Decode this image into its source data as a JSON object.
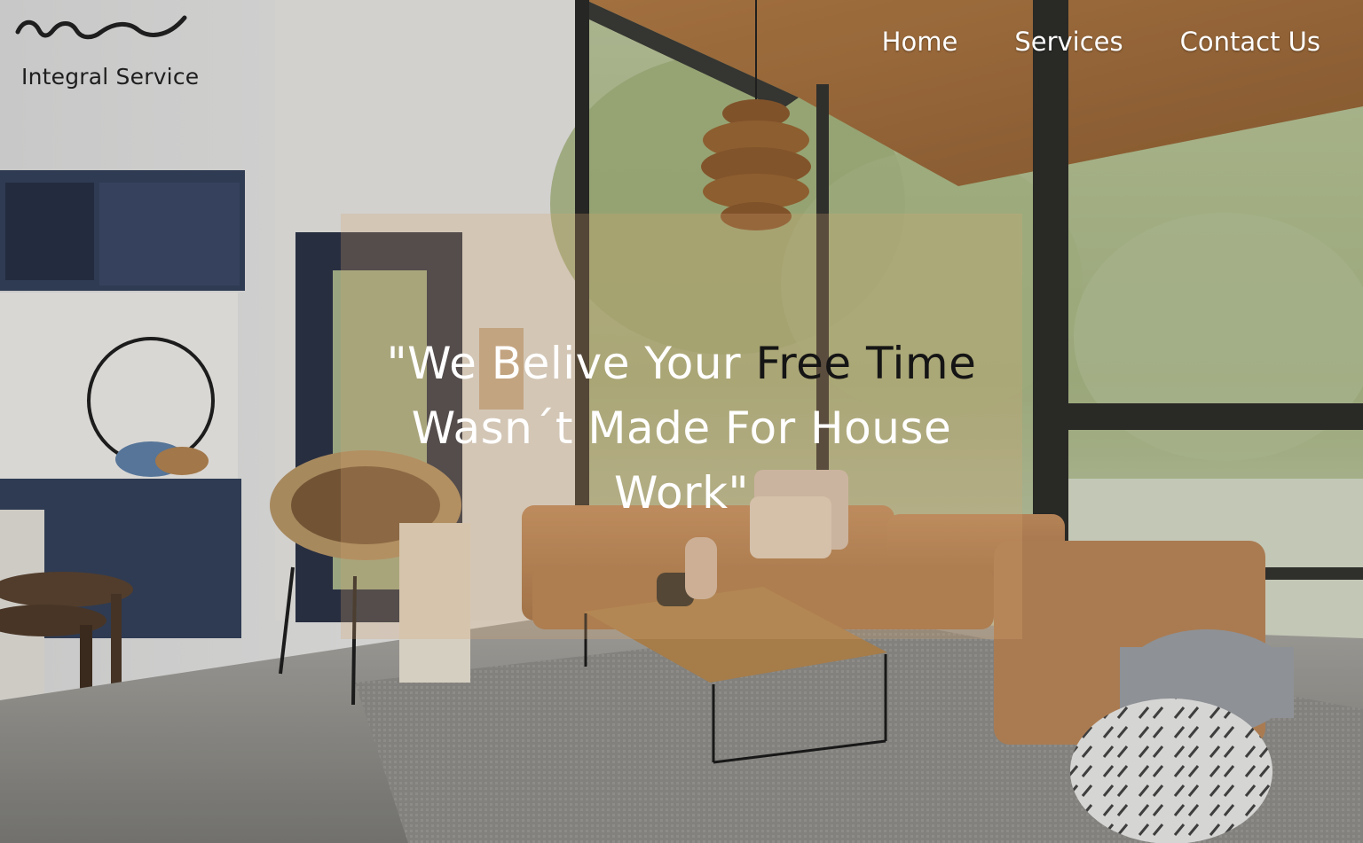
{
  "brand": {
    "name": "Integral Service",
    "logo_icon": "wave-logo-icon"
  },
  "nav": {
    "items": [
      {
        "label": "Home"
      },
      {
        "label": "Services"
      },
      {
        "label": "Contact Us"
      }
    ]
  },
  "hero": {
    "quote_part1": "\"We Belive Your ",
    "quote_highlight": "Free Time",
    "quote_part2": " Wasn´t Made For House Work\"",
    "background": "modern living room with leather sectional sofa, wicker chair, pendant lamp and large windows",
    "colors": {
      "panel_tint": "#daa870",
      "text": "#ffffff",
      "highlight": "#151515"
    }
  }
}
